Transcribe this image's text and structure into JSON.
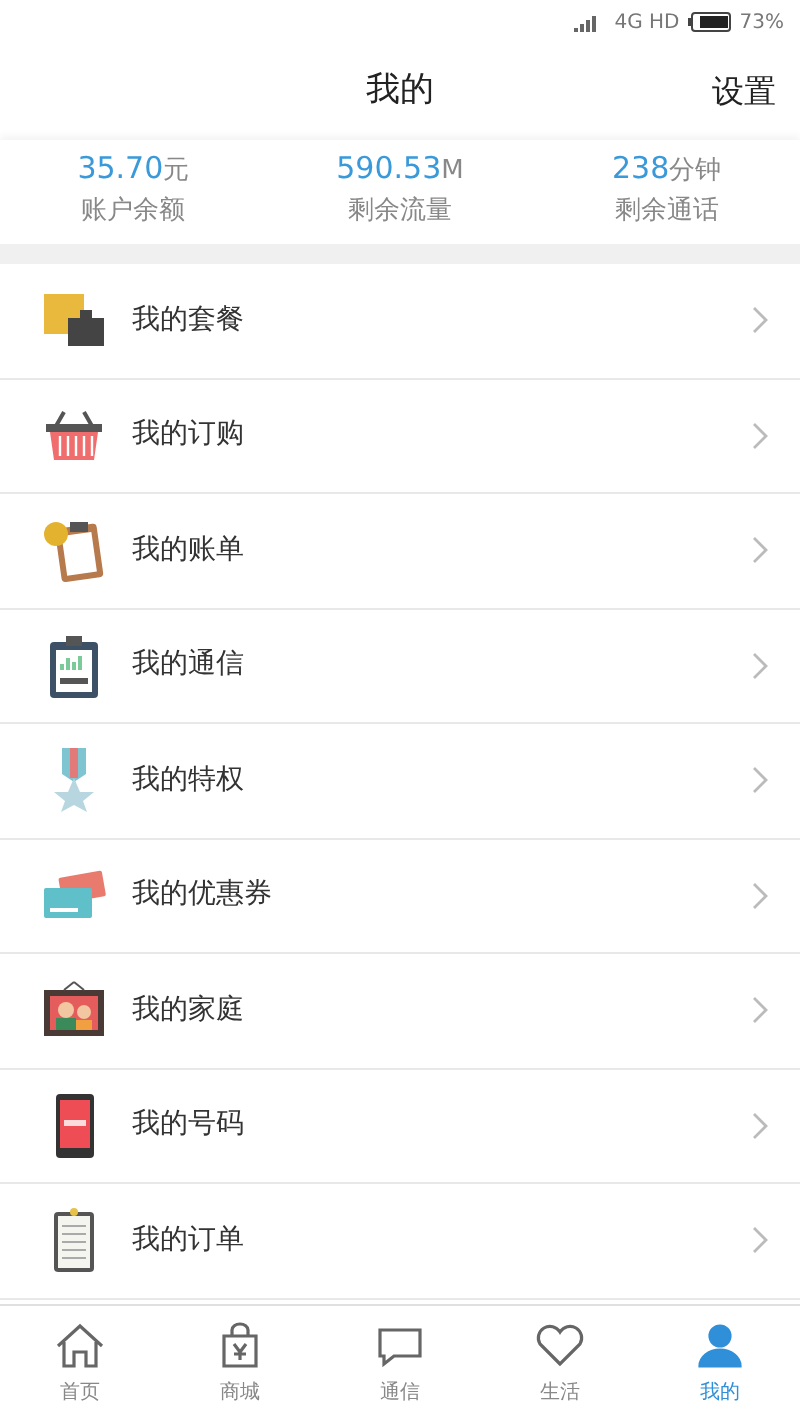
{
  "status_bar": {
    "network": "4G HD",
    "battery": "73%"
  },
  "header": {
    "title": "我的",
    "action": "设置"
  },
  "stats": [
    {
      "value": "35.70",
      "unit": "元",
      "label": "账户余额"
    },
    {
      "value": "590.53",
      "unit": "M",
      "label": "剩余流量"
    },
    {
      "value": "238",
      "unit": "分钟",
      "label": "剩余通话"
    }
  ],
  "menu": [
    {
      "kind": "package",
      "label": "我的套餐"
    },
    {
      "kind": "basket",
      "label": "我的订购"
    },
    {
      "kind": "bill",
      "label": "我的账单"
    },
    {
      "kind": "chart",
      "label": "我的通信"
    },
    {
      "kind": "medal",
      "label": "我的特权"
    },
    {
      "kind": "coupon",
      "label": "我的优惠券"
    },
    {
      "kind": "family",
      "label": "我的家庭"
    },
    {
      "kind": "phone",
      "label": "我的号码"
    },
    {
      "kind": "order",
      "label": "我的订单"
    }
  ],
  "tab_bar": [
    {
      "kind": "home",
      "label": "首页",
      "selected": false
    },
    {
      "kind": "shop",
      "label": "商城",
      "selected": false
    },
    {
      "kind": "chat",
      "label": "通信",
      "selected": false
    },
    {
      "kind": "life",
      "label": "生活",
      "selected": false
    },
    {
      "kind": "me",
      "label": "我的",
      "selected": true
    }
  ]
}
